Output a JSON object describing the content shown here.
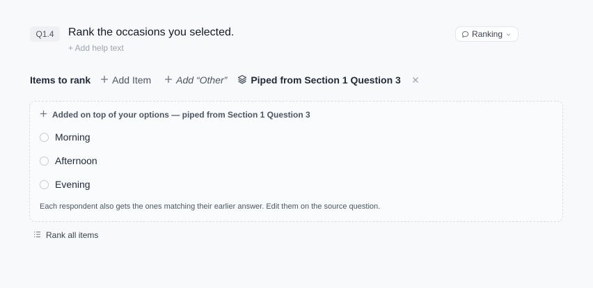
{
  "question": {
    "number": "Q1.4",
    "title": "Rank the occasions you selected.",
    "help_link": "+ Add help text",
    "type": {
      "label": "Ranking",
      "icon": "speech-bubble-icon"
    }
  },
  "toolbar": {
    "items_label": "Items to rank",
    "add_item_label": "Add Item",
    "add_other_label": "Add “Other”",
    "piped_label": "Piped from Section 1 Question 3"
  },
  "piped_box": {
    "note": "Added on top of your options — piped from Section 1 Question 3",
    "options": [
      {
        "label": "Morning"
      },
      {
        "label": "Afternoon"
      },
      {
        "label": "Evening"
      }
    ],
    "footnote": "Each respondent also gets the ones matching their earlier answer. Edit them on the source question."
  },
  "rank_all": {
    "label": "Rank all items"
  },
  "colors": {
    "background": "#f8f9fb",
    "text_primary": "#1f2937",
    "text_muted": "#9ca3af",
    "border": "#d9dde3"
  }
}
